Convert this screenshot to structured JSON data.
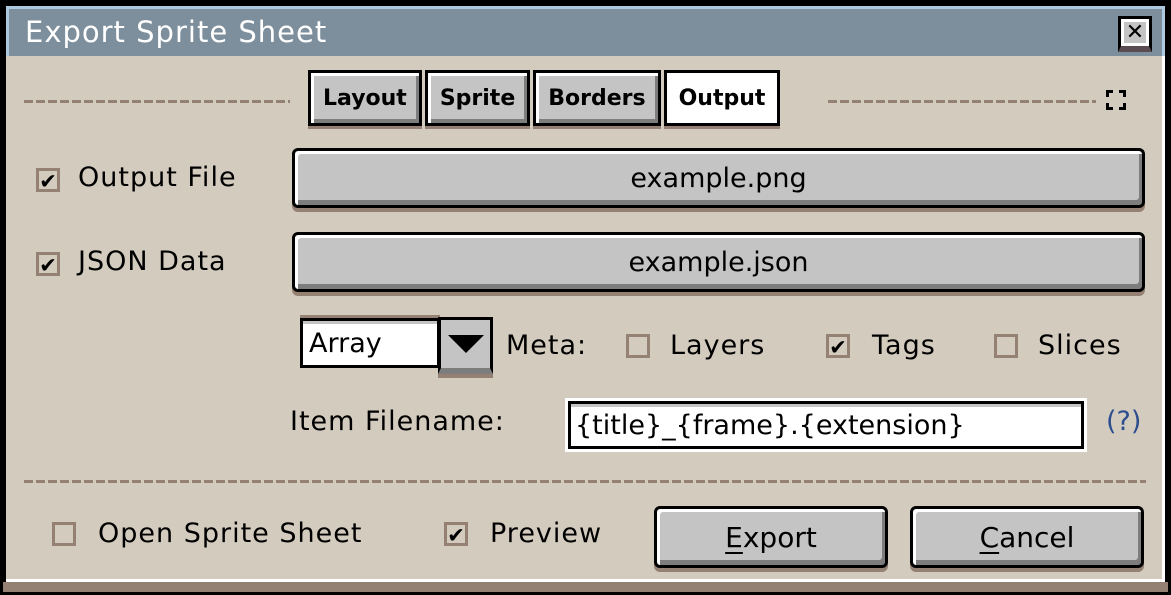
{
  "window": {
    "title": "Export Sprite Sheet",
    "close_icon": "close-icon"
  },
  "tabs": [
    {
      "label": "Layout",
      "active": false
    },
    {
      "label": "Sprite",
      "active": false
    },
    {
      "label": "Borders",
      "active": false
    },
    {
      "label": "Output",
      "active": true
    }
  ],
  "output_file": {
    "label": "Output File",
    "checked": true,
    "value": "example.png"
  },
  "json_data": {
    "label": "JSON Data",
    "checked": true,
    "value": "example.json"
  },
  "format": {
    "selected": "Array"
  },
  "meta": {
    "label": "Meta:",
    "options": [
      {
        "label": "Layers",
        "checked": false
      },
      {
        "label": "Tags",
        "checked": true
      },
      {
        "label": "Slices",
        "checked": false
      }
    ]
  },
  "item_filename": {
    "label": "Item Filename:",
    "value": "{title}_{frame}.{extension}",
    "help": "(?)"
  },
  "footer": {
    "open_sprite_sheet": {
      "label": "Open Sprite Sheet",
      "checked": false
    },
    "preview": {
      "label": "Preview",
      "checked": true
    },
    "export": {
      "mnemonic": "E",
      "rest": "xport"
    },
    "cancel": {
      "mnemonic": "C",
      "rest": "ancel"
    }
  },
  "colors": {
    "titlebar": "#7d8f9c",
    "body": "#d3cbbe",
    "button": "#c4c4c4",
    "help_link": "#2c4d8e"
  },
  "checkmark": "✔"
}
